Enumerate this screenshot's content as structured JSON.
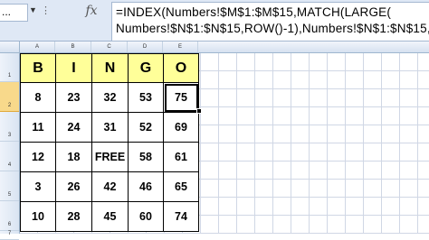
{
  "formula_bar": {
    "name_box": "...",
    "fx_label": "fx",
    "formula_line_1": "=INDEX(Numbers!$M$1:$M$15,MATCH(LARGE(",
    "formula_line_2": "Numbers!$N$1:$N$15,ROW()-1),Numbers!$N$1:$N$15,"
  },
  "columns": [
    "A",
    "B",
    "C",
    "D",
    "E"
  ],
  "rows": [
    "1",
    "2",
    "3",
    "4",
    "5",
    "6",
    "7"
  ],
  "bingo": {
    "headers": [
      "B",
      "I",
      "N",
      "G",
      "O"
    ],
    "rows": [
      [
        "8",
        "23",
        "32",
        "53",
        "75"
      ],
      [
        "11",
        "24",
        "31",
        "52",
        "69"
      ],
      [
        "12",
        "18",
        "FREE",
        "58",
        "61"
      ],
      [
        "3",
        "26",
        "42",
        "46",
        "65"
      ],
      [
        "10",
        "28",
        "45",
        "60",
        "74"
      ]
    ]
  },
  "selected_cell": "E2"
}
